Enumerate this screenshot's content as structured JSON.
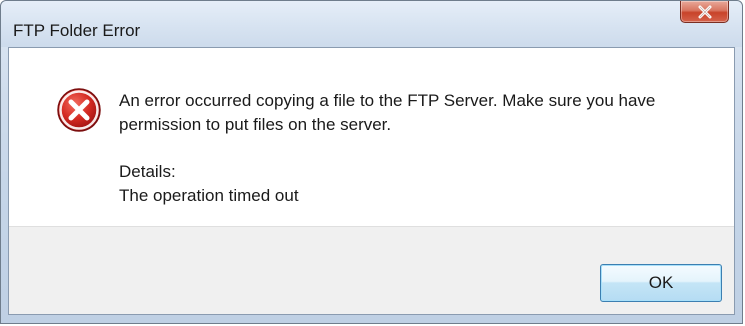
{
  "window": {
    "title": "FTP Folder Error"
  },
  "dialog": {
    "message": "An error occurred copying a file to the FTP Server.  Make sure you have permission to put files on the server.",
    "details_label": "Details:",
    "details_text": "The operation timed out",
    "ok_label": "OK"
  },
  "icons": {
    "error": "error-icon",
    "close": "close-icon"
  },
  "colors": {
    "error_red": "#c8191c",
    "close_red": "#c8432a",
    "ok_border": "#3c7fb1"
  }
}
